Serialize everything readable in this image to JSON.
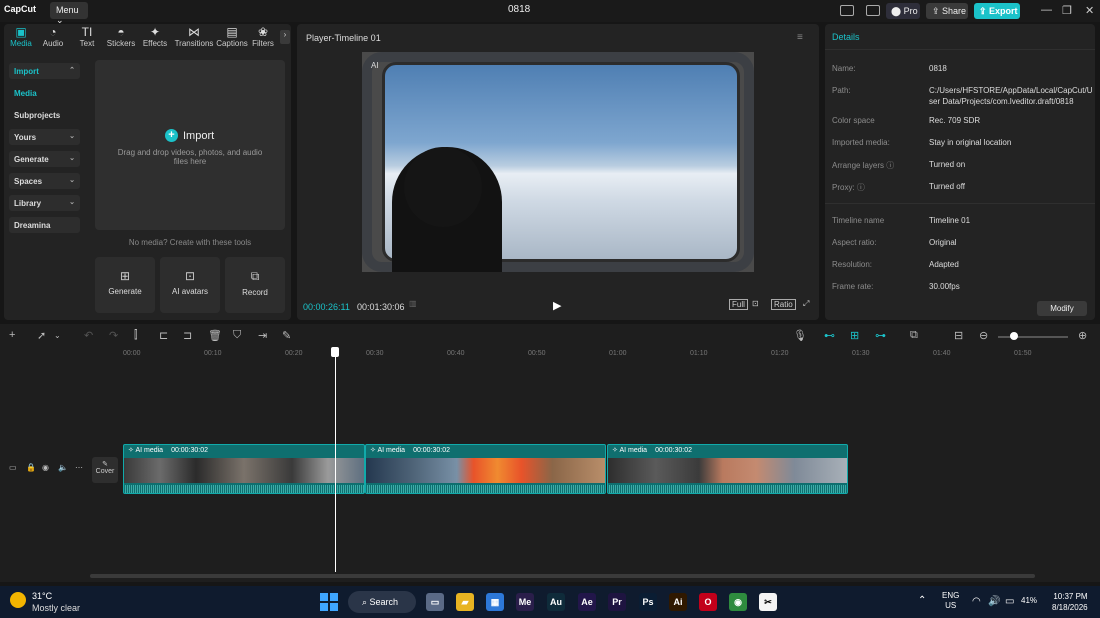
{
  "titlebar": {
    "logo": "CapCut",
    "menu": "Menu ⌄",
    "title": "0818",
    "pro": "⬤ Pro",
    "share": "⇪ Share",
    "export": "⇪ Export",
    "minimize": "—",
    "maximize": "❐",
    "close": "✕"
  },
  "tool_tabs": [
    {
      "label": "Media",
      "icon": "media-icon",
      "glyph": "▣"
    },
    {
      "label": "Audio",
      "icon": "audio-icon",
      "glyph": "◔"
    },
    {
      "label": "Text",
      "icon": "text-icon",
      "glyph": "TI"
    },
    {
      "label": "Stickers",
      "icon": "stickers-icon",
      "glyph": "◓"
    },
    {
      "label": "Effects",
      "icon": "effects-icon",
      "glyph": "✦"
    },
    {
      "label": "Transitions",
      "icon": "transitions-icon",
      "glyph": "⋈"
    },
    {
      "label": "Captions",
      "icon": "captions-icon",
      "glyph": "▤"
    },
    {
      "label": "Filters",
      "icon": "filters-icon",
      "glyph": "❀"
    }
  ],
  "sidebar": {
    "items": [
      {
        "label": "Import",
        "chevron": "⌃"
      },
      {
        "label": "Media",
        "chevron": ""
      },
      {
        "label": "Subprojects",
        "chevron": ""
      },
      {
        "label": "Yours",
        "chevron": "⌄"
      },
      {
        "label": "Generate",
        "chevron": "⌄"
      },
      {
        "label": "Spaces",
        "chevron": "⌄"
      },
      {
        "label": "Library",
        "chevron": "⌄"
      },
      {
        "label": "Dreamina",
        "chevron": ""
      }
    ]
  },
  "import_area": {
    "label": "Import",
    "hint": "Drag and drop videos, photos, and audio files here",
    "no_media": "No media? Create with these tools"
  },
  "tool_cards": [
    {
      "label": "Generate",
      "glyph": "⊞"
    },
    {
      "label": "AI avatars",
      "glyph": "⊡"
    },
    {
      "label": "Record",
      "glyph": "⧉"
    }
  ],
  "player": {
    "title": "Player-Timeline 01",
    "ai_tag": "AI",
    "time_current": "00:00:26:11",
    "time_total": "00:01:30:06",
    "full_label": "Full",
    "ratio_label": "Ratio"
  },
  "details": {
    "title": "Details",
    "rows": [
      {
        "label": "Name:",
        "value": "0818"
      },
      {
        "label": "Path:",
        "value": "C:/Users/HFSTORE/AppData/Local/CapCut/User Data/Projects/com.lveditor.draft/0818"
      },
      {
        "label": "Color space",
        "value": "Rec. 709 SDR"
      },
      {
        "label": "Imported media:",
        "value": "Stay in original location"
      },
      {
        "label": "Arrange layers ⓘ",
        "value": "Turned on"
      },
      {
        "label": "Proxy: ⓘ",
        "value": "Turned off"
      },
      {
        "label": "Timeline name",
        "value": "Timeline 01"
      },
      {
        "label": "Aspect ratio:",
        "value": "Original"
      },
      {
        "label": "Resolution:",
        "value": "Adapted"
      },
      {
        "label": "Frame rate:",
        "value": "30.00fps"
      }
    ],
    "modify": "Modify"
  },
  "ruler": {
    "ticks": [
      "00:00",
      "00:10",
      "00:20",
      "00:30",
      "00:40",
      "00:50",
      "01:00",
      "01:10",
      "01:20",
      "01:30",
      "01:40",
      "01:50"
    ]
  },
  "track": {
    "cover": "Cover",
    "clips": [
      {
        "label": "AI media",
        "duration": "00:00:30:02"
      },
      {
        "label": "AI media",
        "duration": "00:00:30:02"
      },
      {
        "label": "AI media",
        "duration": "00:00:30:02"
      }
    ]
  },
  "taskbar": {
    "temperature": "31°C",
    "condition": "Mostly clear",
    "search": "Search",
    "apps": [
      {
        "name": "file-explorer-icon",
        "label": "▭",
        "color": "#5a6a86"
      },
      {
        "name": "folder-icon",
        "label": "▰",
        "color": "#e8b422"
      },
      {
        "name": "store-icon",
        "label": "▦",
        "color": "#2d78d8"
      },
      {
        "name": "media-encoder-icon",
        "label": "Me",
        "color": "#2a1e4a"
      },
      {
        "name": "audition-icon",
        "label": "Au",
        "color": "#0f2b3a"
      },
      {
        "name": "after-effects-icon",
        "label": "Ae",
        "color": "#22164a"
      },
      {
        "name": "premiere-icon",
        "label": "Pr",
        "color": "#1e1440"
      },
      {
        "name": "photoshop-icon",
        "label": "Ps",
        "color": "#0a1d33"
      },
      {
        "name": "illustrator-icon",
        "label": "Ai",
        "color": "#2f1800"
      },
      {
        "name": "opera-icon",
        "label": "O",
        "color": "#c2001a"
      },
      {
        "name": "chrome-icon",
        "label": "◉",
        "color": "#2e8b3e"
      },
      {
        "name": "capcut-icon",
        "label": "✂",
        "color": "#f4f4f4"
      }
    ],
    "lang_1": "ENG",
    "lang_2": "US",
    "battery": "41%",
    "time": "10:37 PM",
    "date": "8/18/2026"
  },
  "colors": {
    "accent": "#1bc2c9",
    "clip": "#0f6f6f"
  }
}
